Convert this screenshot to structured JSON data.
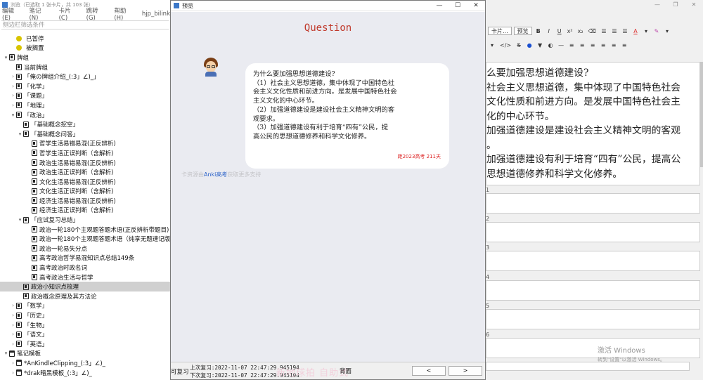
{
  "browser": {
    "title": "浏览（已选取 1 张卡片，共 103 张）",
    "menu": [
      "编辑(E)",
      "笔记 (N)",
      "卡片(C)",
      "跳转(G)",
      "帮助(H)",
      "hjp_bilink"
    ],
    "filter_placeholder": "侧边栏筛选条件",
    "tree": [
      {
        "label": "已暂停",
        "level": 1,
        "icon": "dot-yellow",
        "arrow": ""
      },
      {
        "label": "被搁置",
        "level": 1,
        "icon": "dot-yellow",
        "arrow": ""
      },
      {
        "label": "牌组",
        "level": 0,
        "icon": "deck",
        "arrow": "v"
      },
      {
        "label": "当前牌组",
        "level": 1,
        "icon": "deck",
        "arrow": ""
      },
      {
        "label": "「俺の牌组介绍_(:3」∠)_」",
        "level": 1,
        "icon": "deck",
        "arrow": ">"
      },
      {
        "label": "「化学」",
        "level": 1,
        "icon": "deck",
        "arrow": ">"
      },
      {
        "label": "「课题」",
        "level": 1,
        "icon": "deck",
        "arrow": ">"
      },
      {
        "label": "「地理」",
        "level": 1,
        "icon": "deck",
        "arrow": ">"
      },
      {
        "label": "「政治」",
        "level": 1,
        "icon": "deck",
        "arrow": "v"
      },
      {
        "label": "「基础概念挖空」",
        "level": 2,
        "icon": "deck",
        "arrow": ""
      },
      {
        "label": "「基础概念问答」",
        "level": 2,
        "icon": "deck",
        "arrow": "v"
      },
      {
        "label": "哲学生活易错易混(正反辨析)",
        "level": 3,
        "icon": "deck",
        "arrow": ""
      },
      {
        "label": "哲学生活正误判断（含解析)",
        "level": 3,
        "icon": "deck",
        "arrow": ""
      },
      {
        "label": "政治生活易错易混(正反辨析)",
        "level": 3,
        "icon": "deck",
        "arrow": ""
      },
      {
        "label": "政治生活正误判断（含解析)",
        "level": 3,
        "icon": "deck",
        "arrow": ""
      },
      {
        "label": "文化生活易错易混(正反辨析)",
        "level": 3,
        "icon": "deck",
        "arrow": ""
      },
      {
        "label": "文化生活正误判断（含解析)",
        "level": 3,
        "icon": "deck",
        "arrow": ""
      },
      {
        "label": "经济生活易错易混(正反辨析)",
        "level": 3,
        "icon": "deck",
        "arrow": ""
      },
      {
        "label": "经济生活正误判断（含解析)",
        "level": 3,
        "icon": "deck",
        "arrow": ""
      },
      {
        "label": "「应试复习总结」",
        "level": 2,
        "icon": "deck",
        "arrow": "v"
      },
      {
        "label": "政治一轮180个主观题答题术语(正反辨析带题目)",
        "level": 3,
        "icon": "deck",
        "arrow": ""
      },
      {
        "label": "政治一轮180个主观题答题术语（纯享无题速记版)",
        "level": 3,
        "icon": "deck",
        "arrow": ""
      },
      {
        "label": "政治一轮易失分点",
        "level": 3,
        "icon": "deck",
        "arrow": ""
      },
      {
        "label": "高考政治哲学易混知识点总结149条",
        "level": 3,
        "icon": "deck",
        "arrow": ""
      },
      {
        "label": "高考政治时政名词",
        "level": 3,
        "icon": "deck",
        "arrow": ""
      },
      {
        "label": "高考政治生活与哲学",
        "level": 3,
        "icon": "deck",
        "arrow": ""
      },
      {
        "label": "政治小知识点梳理",
        "level": 2,
        "icon": "deck",
        "arrow": "",
        "selected": true
      },
      {
        "label": "政治概念原理及其方法论",
        "level": 2,
        "icon": "deck",
        "arrow": ""
      },
      {
        "label": "「数学」",
        "level": 1,
        "icon": "deck",
        "arrow": ">"
      },
      {
        "label": "「历史」",
        "level": 1,
        "icon": "deck",
        "arrow": ">"
      },
      {
        "label": "「生物」",
        "level": 1,
        "icon": "deck",
        "arrow": ">"
      },
      {
        "label": "「语文」",
        "level": 1,
        "icon": "deck",
        "arrow": ">"
      },
      {
        "label": "「英语」",
        "level": 1,
        "icon": "deck",
        "arrow": ">"
      },
      {
        "label": "笔记模板",
        "level": 0,
        "icon": "model",
        "arrow": "v"
      },
      {
        "label": "*AnKindleClipping_(:3」∠)_",
        "level": 1,
        "icon": "model",
        "arrow": ">"
      },
      {
        "label": "*drak暗黑模板_(:3」∠)_",
        "level": 1,
        "icon": "model",
        "arrow": ">"
      }
    ]
  },
  "preview": {
    "title": "预览",
    "header": "Question",
    "question_lines": [
      "为什么要加强思想道德建设?",
      "（1）社会主义思想道德，集中体现了中国特色社",
      "会主义文化性质和前进方向。是发展中国特色社会",
      "主义文化的中心环节。",
      "（2）加强道德建设是建设社会主义精神文明的客",
      "观要求。",
      "（3）加强道德建设有利于培育“四有”公民，提",
      "高公民的思想道德修养和科学文化修养。"
    ],
    "exam_tag": "距2023高考 211天",
    "tip": {
      "prefix": "卡资源由",
      "link": "Anki高考",
      "suffix": "获取更多支持"
    },
    "footer": {
      "review_label": "可复习",
      "last_review": "上次复习:2022-11-07 22:47:29.945194",
      "next_review": "下次复习:2022-11-07 22:47:29.945194",
      "watermark": "新地球拍 自助式",
      "back_label": "背面",
      "prev": "<",
      "next": ">"
    }
  },
  "editor": {
    "titlebar": [
      "—",
      "❐",
      "✕"
    ],
    "toolbar1": [
      "卡片...",
      "预览",
      "B",
      "I",
      "U",
      "x²",
      "x₂",
      "⌫",
      "☰",
      "☰",
      "☰",
      "A",
      "▾",
      "✎",
      "▾"
    ],
    "toolbar2": [
      "▾",
      "</>",
      "S",
      "●",
      "▼",
      "◐",
      "—",
      "≡",
      "≡",
      "≡",
      "≡",
      "≡",
      "≡"
    ],
    "main_field_lines": [
      "么要加强思想道德建设?",
      "  社会主义思想道德，集中体现了中国特色社会",
      "文化性质和前进方向。是发展中国特色社会主",
      "化的中心环节。",
      "  加强道德建设是建设社会主义精神文明的客观",
      "。",
      "  加强道德建设有利于培育“四有”公民，提高公",
      "思想道德修养和科学文化修养。"
    ],
    "field_labels": [
      "1",
      "2",
      "3",
      "4",
      "5",
      "6"
    ],
    "activate": {
      "title": "激活 Windows",
      "subtitle": "转到\"设置\"以激活 Windows。"
    }
  },
  "colors": {
    "question_red": "#c0392b",
    "bubble_bg": "#ffffff",
    "content_bg": "#eaebf1",
    "link_blue": "#2b62c8",
    "tag_red": "#dd2222",
    "dot_yellow": "#d8c400"
  }
}
